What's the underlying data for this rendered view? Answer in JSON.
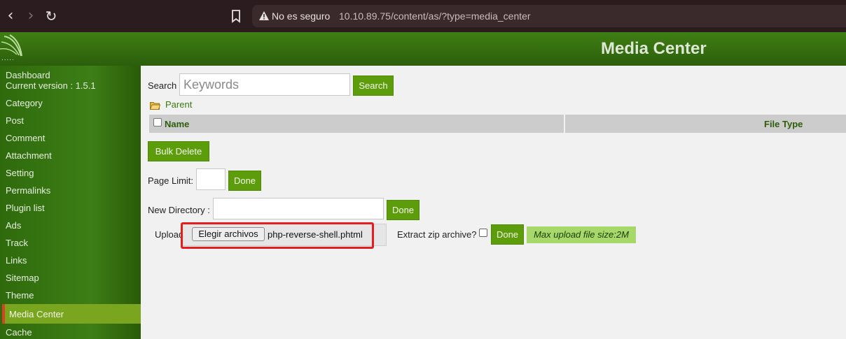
{
  "browser": {
    "security_label": "No es seguro",
    "url": "10.10.89.75/content/as/?type=media_center",
    "icons": [
      "back-icon",
      "forward-icon",
      "reload-icon",
      "bookmark-icon",
      "warning-icon"
    ]
  },
  "header": {
    "title": "Media Center",
    "logo_dots": "....."
  },
  "sidebar": {
    "items": [
      {
        "label": "Dashboard"
      },
      {
        "label": "Current version : 1.5.1"
      },
      {
        "label": "Category"
      },
      {
        "label": "Post"
      },
      {
        "label": "Comment"
      },
      {
        "label": "Attachment"
      },
      {
        "label": "Setting"
      },
      {
        "label": "Permalinks"
      },
      {
        "label": "Plugin list"
      },
      {
        "label": "Ads"
      },
      {
        "label": "Track"
      },
      {
        "label": "Links"
      },
      {
        "label": "Sitemap"
      },
      {
        "label": "Theme"
      },
      {
        "label": "Media Center"
      },
      {
        "label": "Cache"
      }
    ],
    "active": "Media Center"
  },
  "search": {
    "label": "Search",
    "placeholder": "Keywords",
    "button": "Search"
  },
  "parent_link": "Parent",
  "table": {
    "columns": [
      "Name",
      "File Type"
    ]
  },
  "bulk_delete": "Bulk Delete",
  "page_limit": {
    "label": "Page Limit:",
    "value": "",
    "button": "Done"
  },
  "new_directory": {
    "label": "New Directory :",
    "value": "",
    "button": "Done"
  },
  "upload": {
    "label": "Upload :",
    "choose_button": "Elegir archivos",
    "file_name": "php-reverse-shell.phtml",
    "extract_label": "Extract zip archive?",
    "button": "Done",
    "max_size": "Max upload file size:2M"
  },
  "colors": {
    "accent": "#5d9d0c",
    "header_green": "#2c5e0b",
    "highlight_red": "#e41e1e",
    "active_item": "#7aa51e"
  }
}
